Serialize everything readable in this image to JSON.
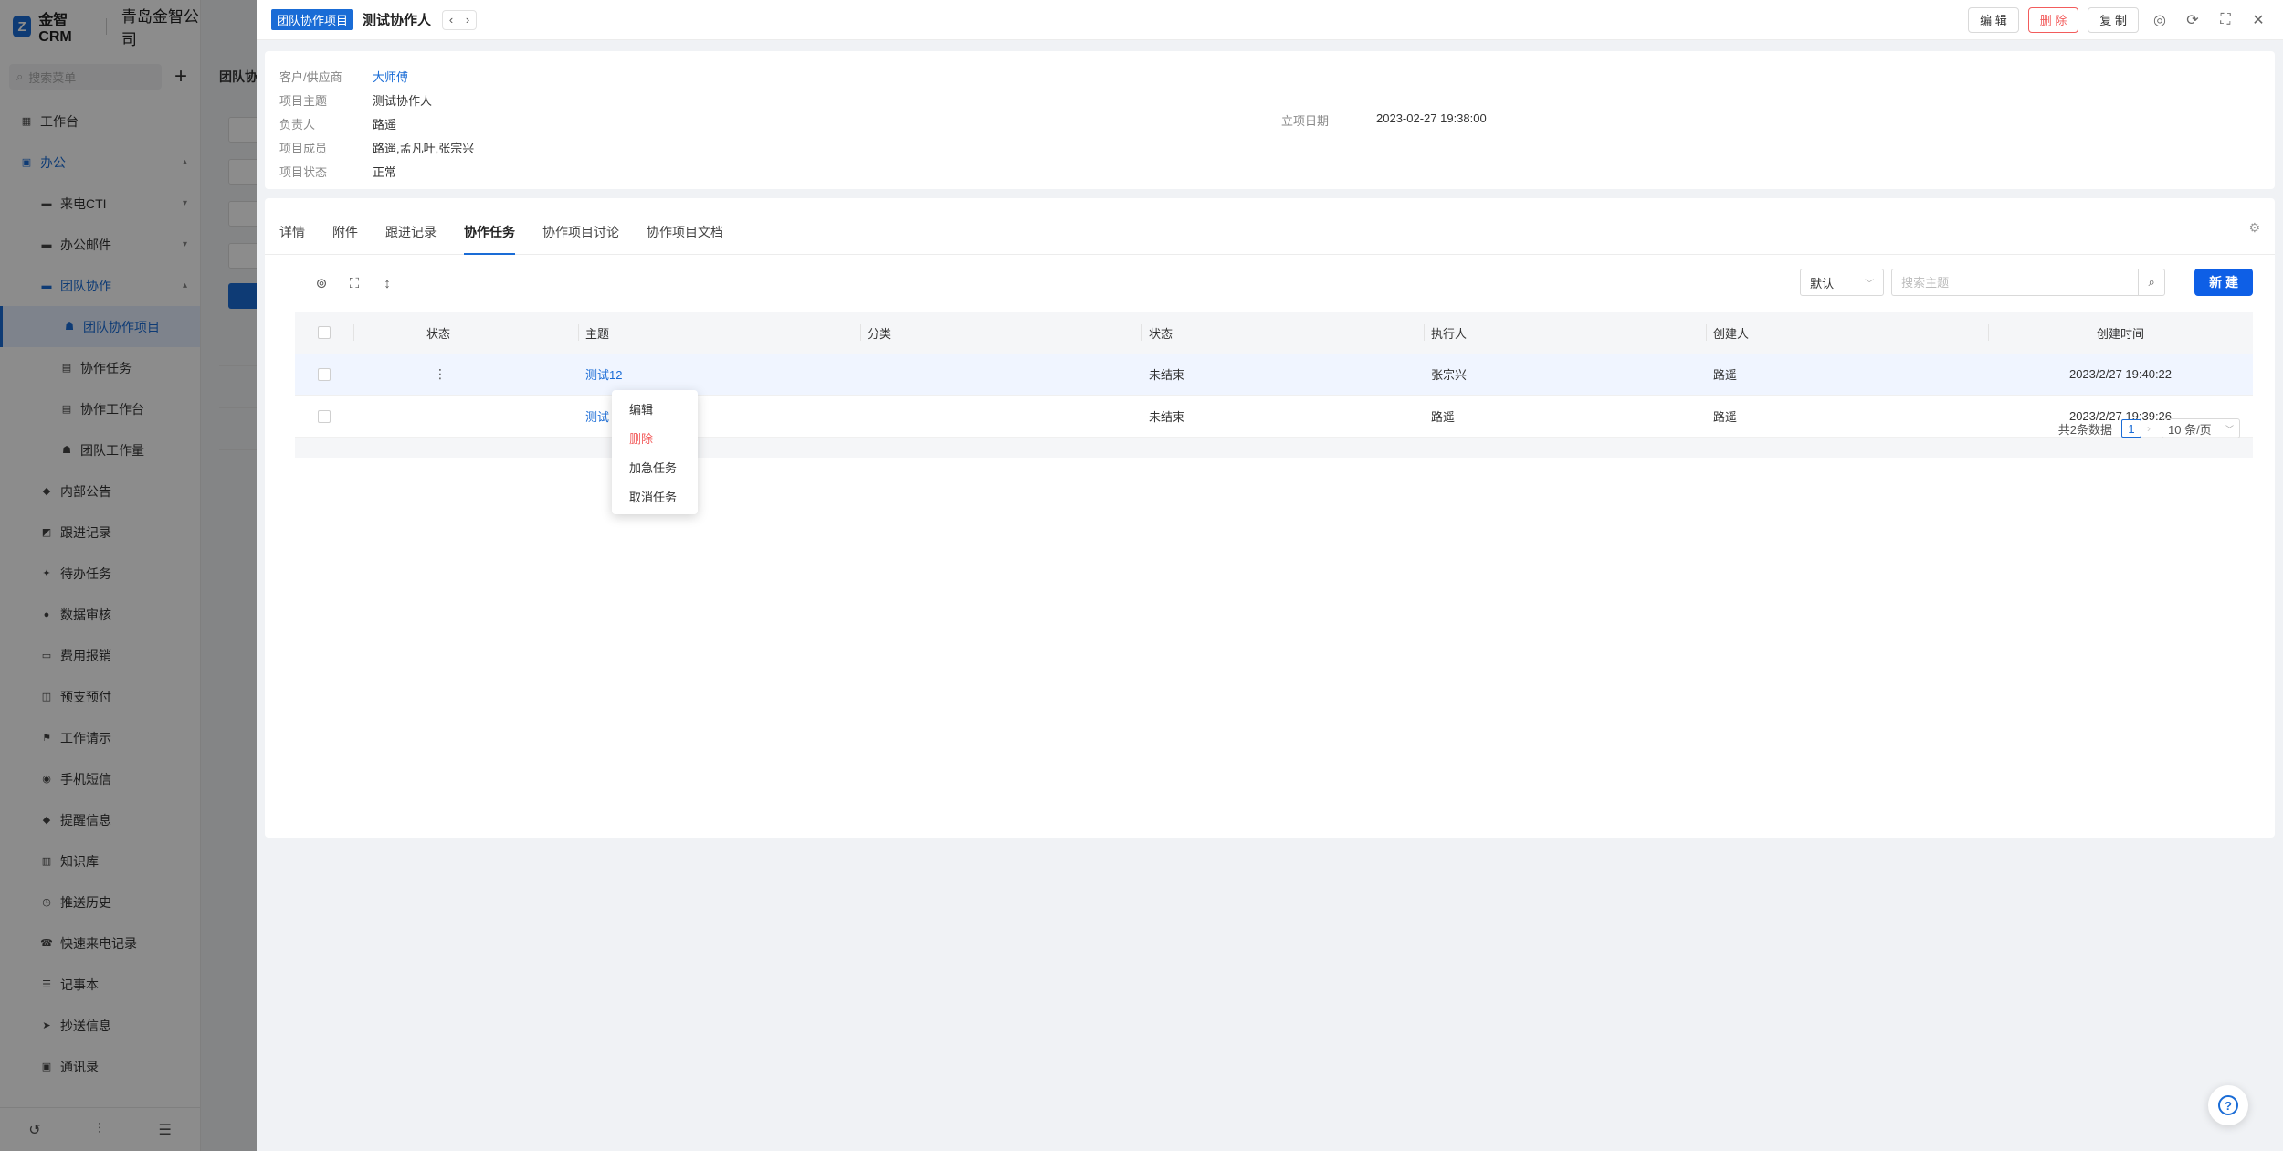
{
  "app": {
    "logo_letter": "Z",
    "name": "金智CRM",
    "company": "青岛金智公司"
  },
  "sidebar": {
    "search_placeholder": "搜索菜单",
    "items": [
      {
        "label": "工作台",
        "icon": "grid-icon"
      },
      {
        "label": "办公",
        "icon": "monitor-icon"
      },
      {
        "label": "来电CTI",
        "icon": "folder-icon"
      },
      {
        "label": "办公邮件",
        "icon": "folder-icon"
      },
      {
        "label": "团队协作",
        "icon": "folder-icon"
      },
      {
        "label": "团队协作项目",
        "icon": "team-icon"
      },
      {
        "label": "协作任务",
        "icon": "doc-icon"
      },
      {
        "label": "协作工作台",
        "icon": "doc-icon"
      },
      {
        "label": "团队工作量",
        "icon": "team-icon"
      },
      {
        "label": "内部公告",
        "icon": "bell-icon"
      },
      {
        "label": "跟进记录",
        "icon": "record-icon"
      },
      {
        "label": "待办任务",
        "icon": "pin-icon"
      },
      {
        "label": "数据审核",
        "icon": "user-icon"
      },
      {
        "label": "费用报销",
        "icon": "card-icon"
      },
      {
        "label": "预支预付",
        "icon": "wallet-icon"
      },
      {
        "label": "工作请示",
        "icon": "flag-icon"
      },
      {
        "label": "手机短信",
        "icon": "chat-icon"
      },
      {
        "label": "提醒信息",
        "icon": "bell-icon"
      },
      {
        "label": "知识库",
        "icon": "book-icon"
      },
      {
        "label": "推送历史",
        "icon": "clock-icon"
      },
      {
        "label": "快速来电记录",
        "icon": "phone-icon"
      },
      {
        "label": "记事本",
        "icon": "note-icon"
      },
      {
        "label": "抄送信息",
        "icon": "send-icon"
      },
      {
        "label": "通讯录",
        "icon": "contacts-icon"
      }
    ]
  },
  "background": {
    "title": "团队协"
  },
  "drawer": {
    "tag": "团队协作项目",
    "title": "测试协作人",
    "buttons": {
      "edit": "编 辑",
      "delete": "删 除",
      "copy": "复 制"
    },
    "info": {
      "customer_label": "客户/供应商",
      "customer_value": "大师傅",
      "subject_label": "项目主题",
      "subject_value": "测试协作人",
      "owner_label": "负责人",
      "owner_value": "路遥",
      "members_label": "项目成员",
      "members_value": "路遥,孟凡叶,张宗兴",
      "status_label": "项目状态",
      "status_value": "正常",
      "date_label": "立项日期",
      "date_value": "2023-02-27 19:38:00"
    },
    "tabs": [
      "详情",
      "附件",
      "跟进记录",
      "协作任务",
      "协作项目讨论",
      "协作项目文档"
    ],
    "toolbar": {
      "sort_value": "默认",
      "search_placeholder": "搜索主题",
      "new_label": "新 建"
    },
    "table": {
      "headers": {
        "status": "状态",
        "subject": "主题",
        "category": "分类",
        "state": "状态",
        "executor": "执行人",
        "creator": "创建人",
        "created": "创建时间"
      },
      "rows": [
        {
          "subject": "测试12",
          "category": "",
          "state": "未结束",
          "executor": "张宗兴",
          "creator": "路遥",
          "created": "2023/2/27 19:40:22"
        },
        {
          "subject": "测试",
          "category": "",
          "state": "未结束",
          "executor": "路遥",
          "creator": "路遥",
          "created": "2023/2/27 19:39:26"
        }
      ]
    },
    "pager": {
      "total": "共2条数据",
      "page": "1",
      "size": "10 条/页"
    },
    "context_menu": [
      "编辑",
      "删除",
      "加急任务",
      "取消任务"
    ]
  }
}
